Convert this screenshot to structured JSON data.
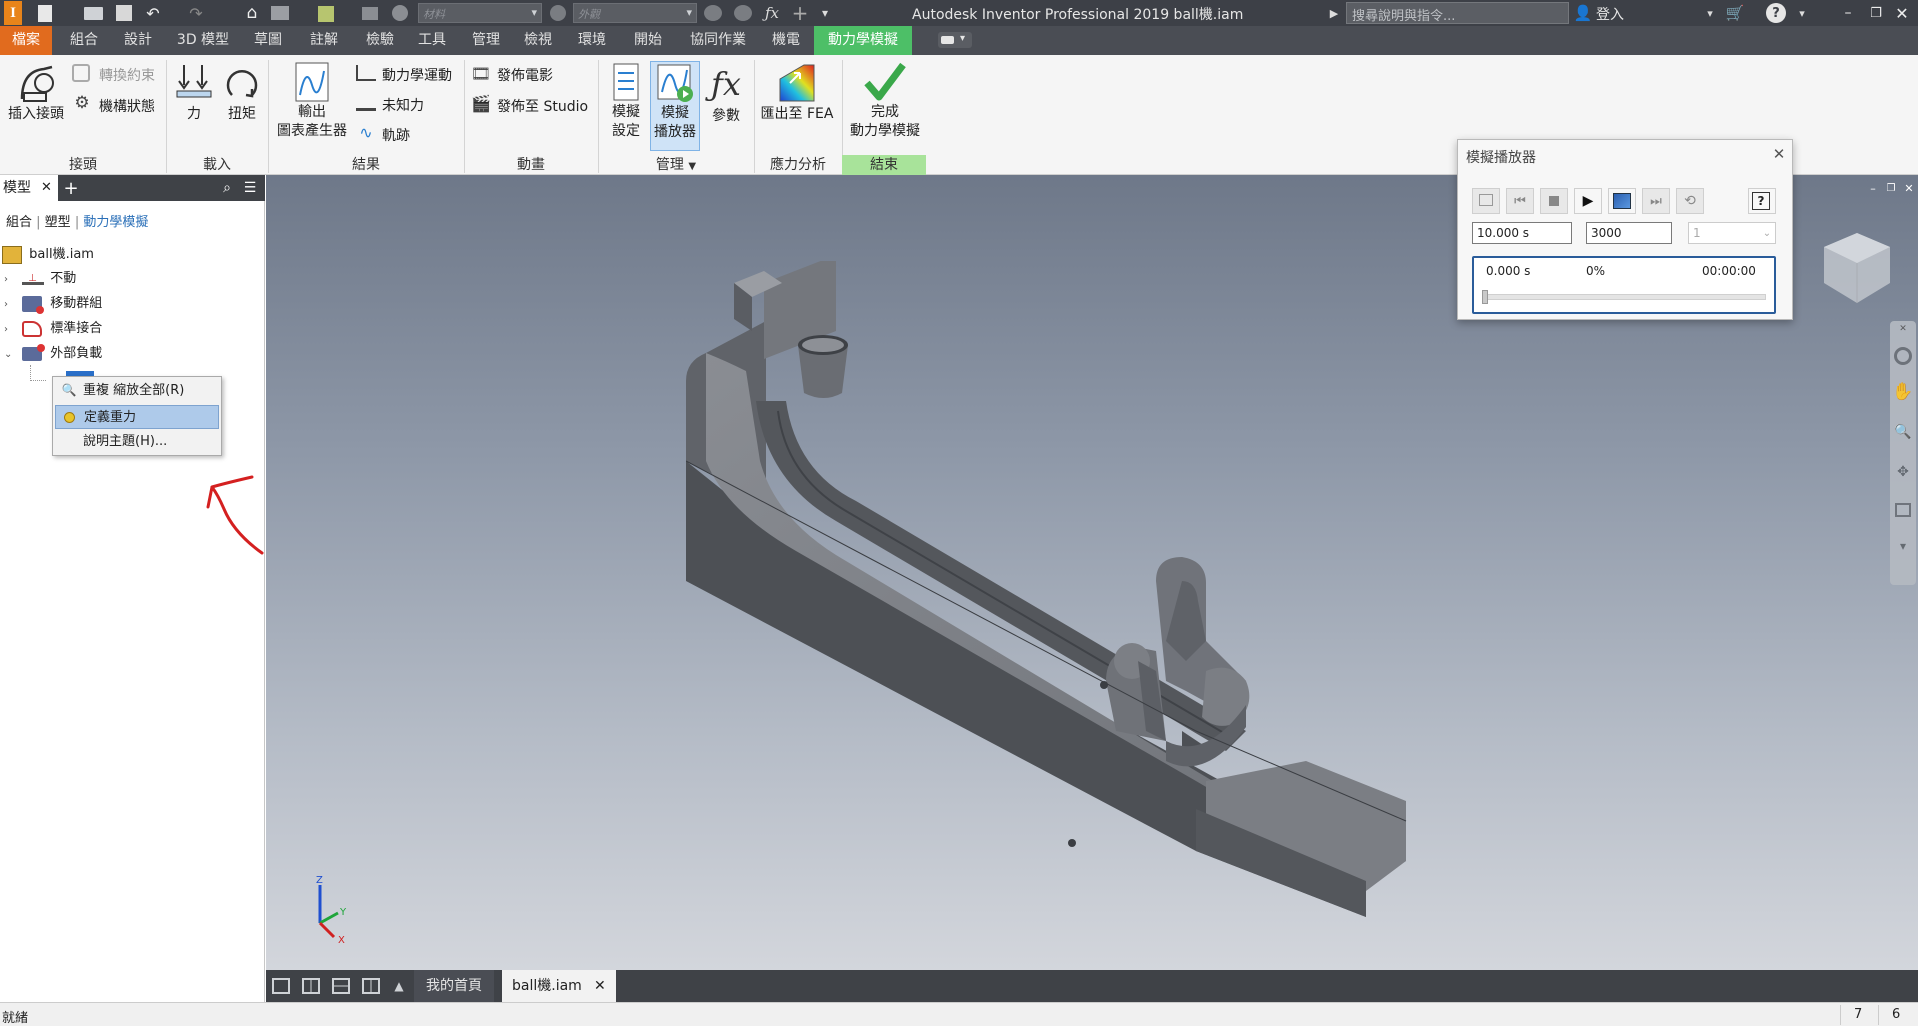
{
  "titlebar": {
    "title": "Autodesk Inventor Professional 2019    ball機.iam",
    "material_placeholder": "材料",
    "appearance_placeholder": "外觀",
    "search_placeholder": "搜尋說明與指令...",
    "signin": "登入"
  },
  "tabs": [
    {
      "label": "檔案"
    },
    {
      "label": "組合"
    },
    {
      "label": "設計"
    },
    {
      "label": "3D 模型"
    },
    {
      "label": "草圖"
    },
    {
      "label": "註解"
    },
    {
      "label": "檢驗"
    },
    {
      "label": "工具"
    },
    {
      "label": "管理"
    },
    {
      "label": "檢視"
    },
    {
      "label": "環境"
    },
    {
      "label": "開始"
    },
    {
      "label": "協同作業"
    },
    {
      "label": "機電"
    },
    {
      "label": "動力學模擬"
    }
  ],
  "ribbon": {
    "insert_joint": "插入接頭",
    "convert_constraints": "轉換約束",
    "mechanism_status": "機構狀態",
    "force": "力",
    "torque": "扭矩",
    "output": "輸出",
    "graph_generator": "圖表產生器",
    "dynamic_motion": "動力學運動",
    "unknown_force": "未知力",
    "trace": "軌跡",
    "publish_movie": "發佈電影",
    "publish_studio": "發佈至 Studio",
    "sim_settings_1": "模擬",
    "sim_settings_2": "設定",
    "sim_player_1": "模擬",
    "sim_player_2": "播放器",
    "parameters": "參數",
    "export_fea": "匯出至 FEA",
    "finish_1": "完成",
    "finish_2": "動力學模擬",
    "groups": {
      "joints": "接頭",
      "loads": "載入",
      "results": "結果",
      "animation": "動畫",
      "manage": "管理",
      "stress": "應力分析",
      "exit": "結束"
    }
  },
  "browser": {
    "tab": "模型",
    "filters": [
      "組合",
      "塑型",
      "動力學模擬"
    ],
    "root": "ball機.iam",
    "nodes": [
      "不動",
      "移動群組",
      "標準接合",
      "外部負載"
    ]
  },
  "context_menu": {
    "items": [
      "重複 縮放全部(R)",
      "定義重力",
      "說明主題(H)..."
    ]
  },
  "player": {
    "title": "模擬播放器",
    "end_time": "10.000 s",
    "images": "3000",
    "filter": "1",
    "current_time": "0.000 s",
    "percent": "0%",
    "elapsed": "00:00:00"
  },
  "doctabs": {
    "home": "我的首頁",
    "doc": "ball機.iam"
  },
  "status": {
    "text": "就緒",
    "num1": "7",
    "num2": "6"
  },
  "colors": {
    "file_tab": "#e16b1e",
    "active_tab": "#4dbf67",
    "title_bar": "#3d4047"
  }
}
